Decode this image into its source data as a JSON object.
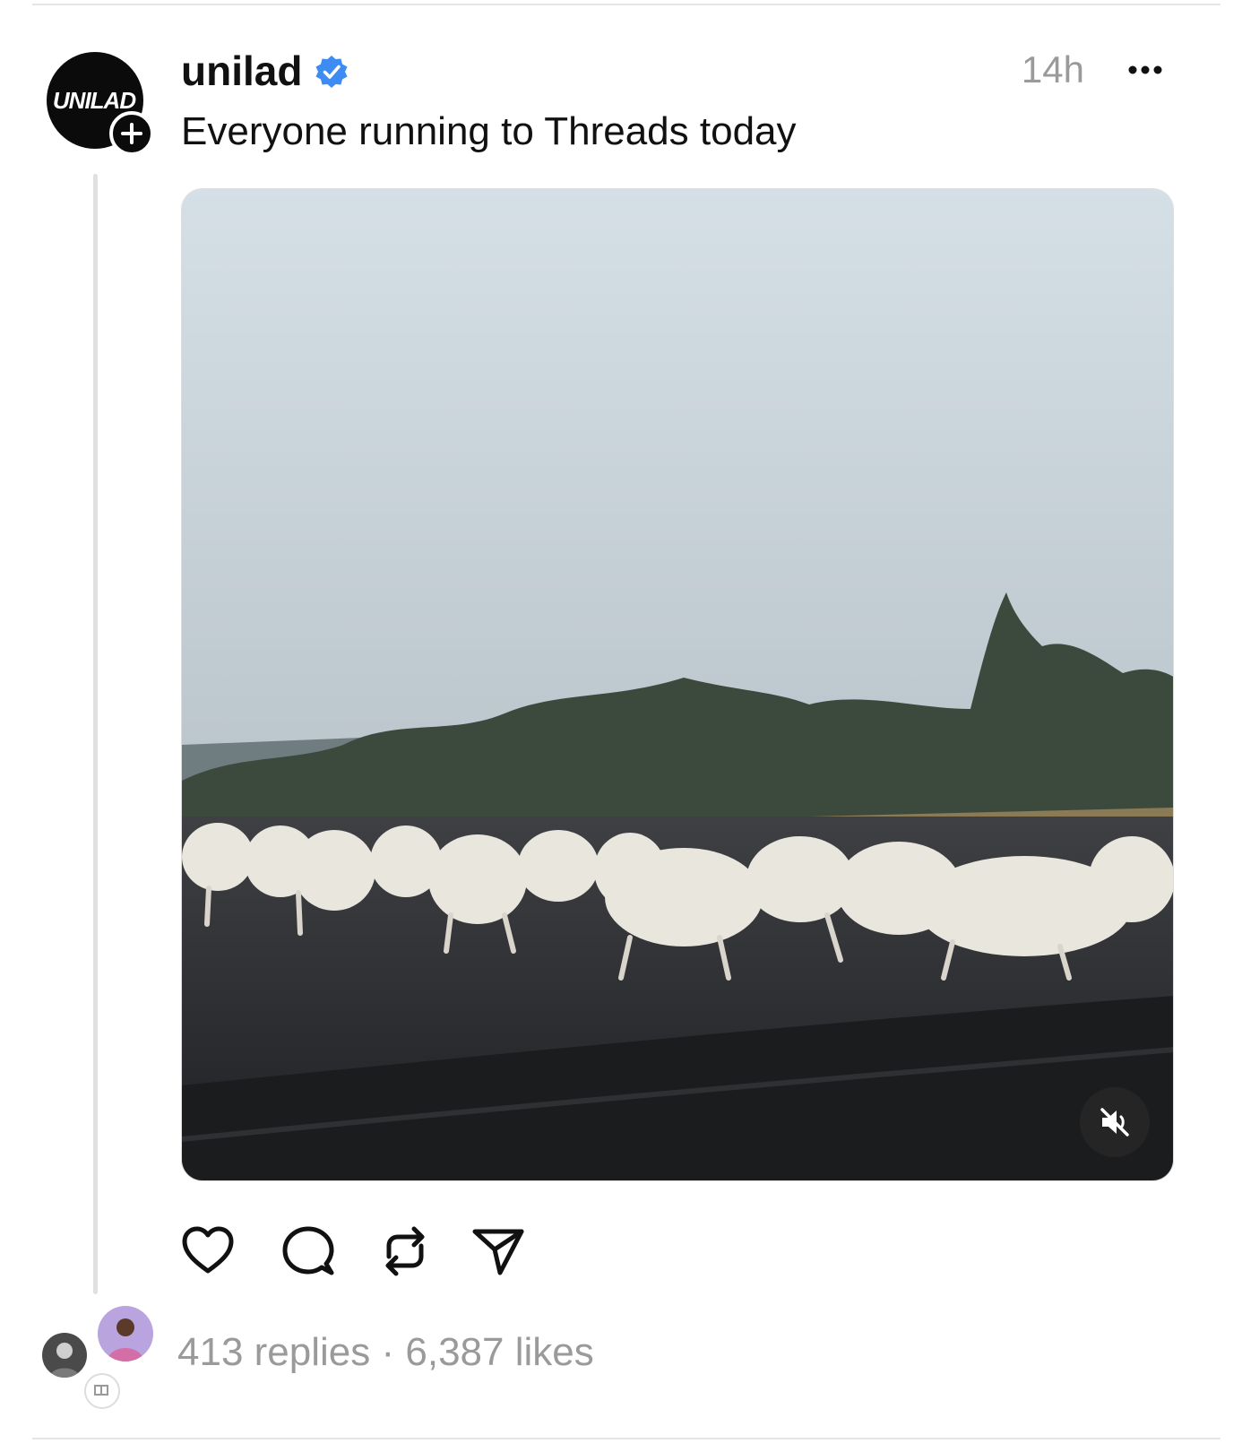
{
  "post": {
    "author": {
      "username": "unilad",
      "verified": true,
      "avatar_text": "UNILAD",
      "avatar_icon": "unilad-logo-icon",
      "follow_icon": "plus-icon"
    },
    "timestamp": "14h",
    "more_icon": "ellipsis-icon",
    "caption": "Everyone running to Threads today",
    "media": {
      "type": "video",
      "mute_icon": "speaker-muted-icon"
    },
    "actions": [
      {
        "name": "like",
        "icon": "heart-icon"
      },
      {
        "name": "reply",
        "icon": "speech-bubble-icon"
      },
      {
        "name": "repost",
        "icon": "repost-icon"
      },
      {
        "name": "share",
        "icon": "send-icon"
      }
    ],
    "stats": {
      "replies": "413 replies",
      "separator": " · ",
      "likes": "6,387 likes"
    }
  },
  "colors": {
    "text": "#111111",
    "muted": "#9a9a9a",
    "verified_badge": "#3d8cf4",
    "divider": "#e6e6e6",
    "thread_line": "#e0e0e0"
  }
}
